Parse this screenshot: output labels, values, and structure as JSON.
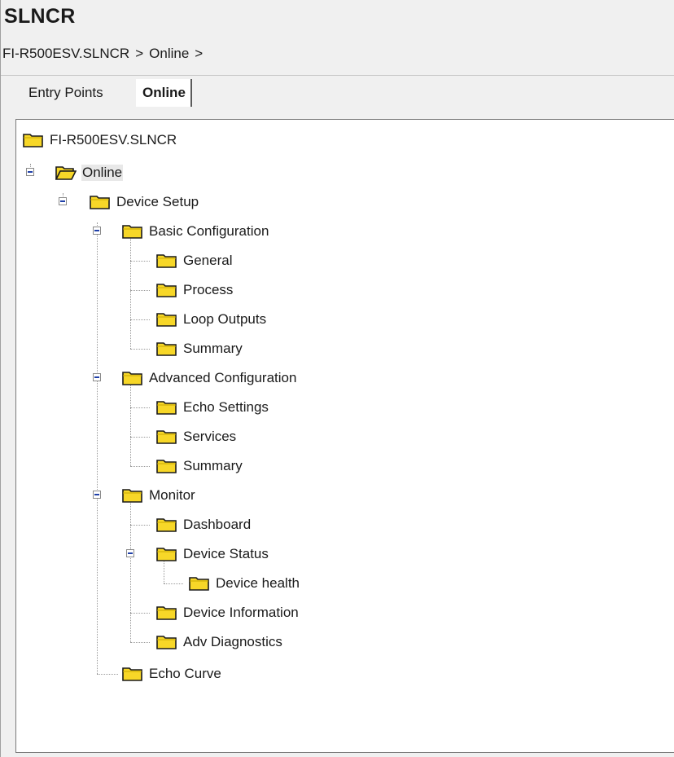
{
  "app_title": "SLNCR",
  "breadcrumb": [
    "FI-R500ESV.SLNCR",
    ">",
    "Online",
    ">"
  ],
  "tabs": [
    {
      "label": "Entry Points",
      "active": false
    },
    {
      "label": "Online",
      "active": true
    }
  ],
  "tree": {
    "root": "FI-R500ESV.SLNCR",
    "online": "Online",
    "device_setup": "Device Setup",
    "basic_configuration": {
      "label": "Basic Configuration",
      "children": [
        "General",
        "Process",
        "Loop Outputs",
        "Summary"
      ]
    },
    "advanced_configuration": {
      "label": "Advanced Configuration",
      "children": [
        "Echo Settings",
        "Services",
        "Summary"
      ]
    },
    "monitor": {
      "label": "Monitor",
      "dashboard": "Dashboard",
      "device_status": "Device Status",
      "device_health": "Device health",
      "device_information": "Device Information",
      "adv_diagnostics": "Adv Diagnostics"
    },
    "echo_curve": "Echo Curve"
  },
  "colors": {
    "folder_fill": "#f7d728",
    "folder_outline": "#1a1a1a",
    "expander_minus": "#1f3fa8"
  }
}
